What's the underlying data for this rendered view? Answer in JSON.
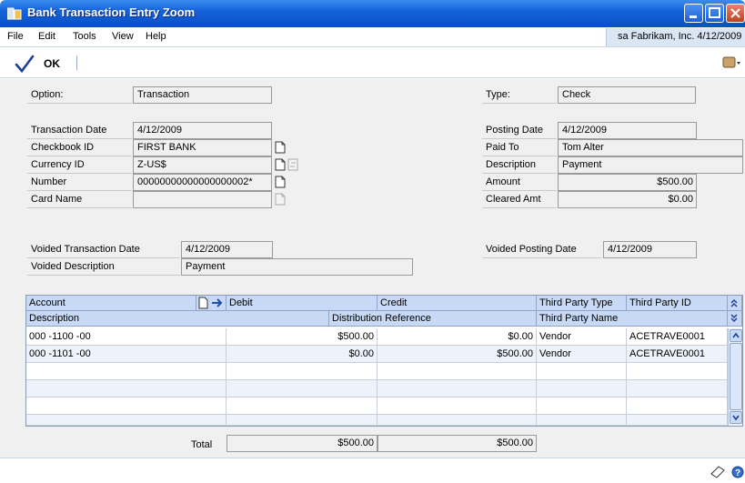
{
  "window": {
    "title": "Bank Transaction Entry Zoom"
  },
  "menu": {
    "items": [
      "File",
      "Edit",
      "Tools",
      "View",
      "Help"
    ],
    "user_info": "sa  Fabrikam, Inc.  4/12/2009"
  },
  "toolbar": {
    "ok_label": "OK"
  },
  "form": {
    "option_label": "Option:",
    "option_value": "Transaction",
    "type_label": "Type:",
    "type_value": "Check",
    "transaction_date_label": "Transaction Date",
    "transaction_date_value": "4/12/2009",
    "checkbook_id_label": "Checkbook ID",
    "checkbook_id_value": "FIRST BANK",
    "currency_id_label": "Currency ID",
    "currency_id_value": "Z-US$",
    "number_label": "Number",
    "number_value": "00000000000000000002*",
    "card_name_label": "Card Name",
    "card_name_value": "",
    "posting_date_label": "Posting Date",
    "posting_date_value": "4/12/2009",
    "paid_to_label": "Paid To",
    "paid_to_value": "Tom Alter",
    "description_label": "Description",
    "description_value": "Payment",
    "amount_label": "Amount",
    "amount_value": "$500.00",
    "cleared_amt_label": "Cleared Amt",
    "cleared_amt_value": "$0.00",
    "voided_transaction_date_label": "Voided Transaction Date",
    "voided_transaction_date_value": "4/12/2009",
    "voided_description_label": "Voided Description",
    "voided_description_value": "Payment",
    "voided_posting_date_label": "Voided Posting Date",
    "voided_posting_date_value": "4/12/2009"
  },
  "grid": {
    "headers": {
      "account": "Account",
      "debit": "Debit",
      "credit": "Credit",
      "third_party_type": "Third Party Type",
      "third_party_id": "Third Party ID",
      "description": "Description",
      "distribution_reference": "Distribution Reference",
      "third_party_name": "Third Party Name"
    },
    "rows": [
      {
        "account": "000 -1100 -00",
        "debit": "$500.00",
        "credit": "$0.00",
        "third_party_type": "Vendor",
        "third_party_id": "ACETRAVE0001"
      },
      {
        "account": "000 -1101 -00",
        "debit": "$0.00",
        "credit": "$500.00",
        "third_party_type": "Vendor",
        "third_party_id": "ACETRAVE0001"
      }
    ]
  },
  "totals": {
    "label": "Total",
    "debit": "$500.00",
    "credit": "$500.00"
  }
}
